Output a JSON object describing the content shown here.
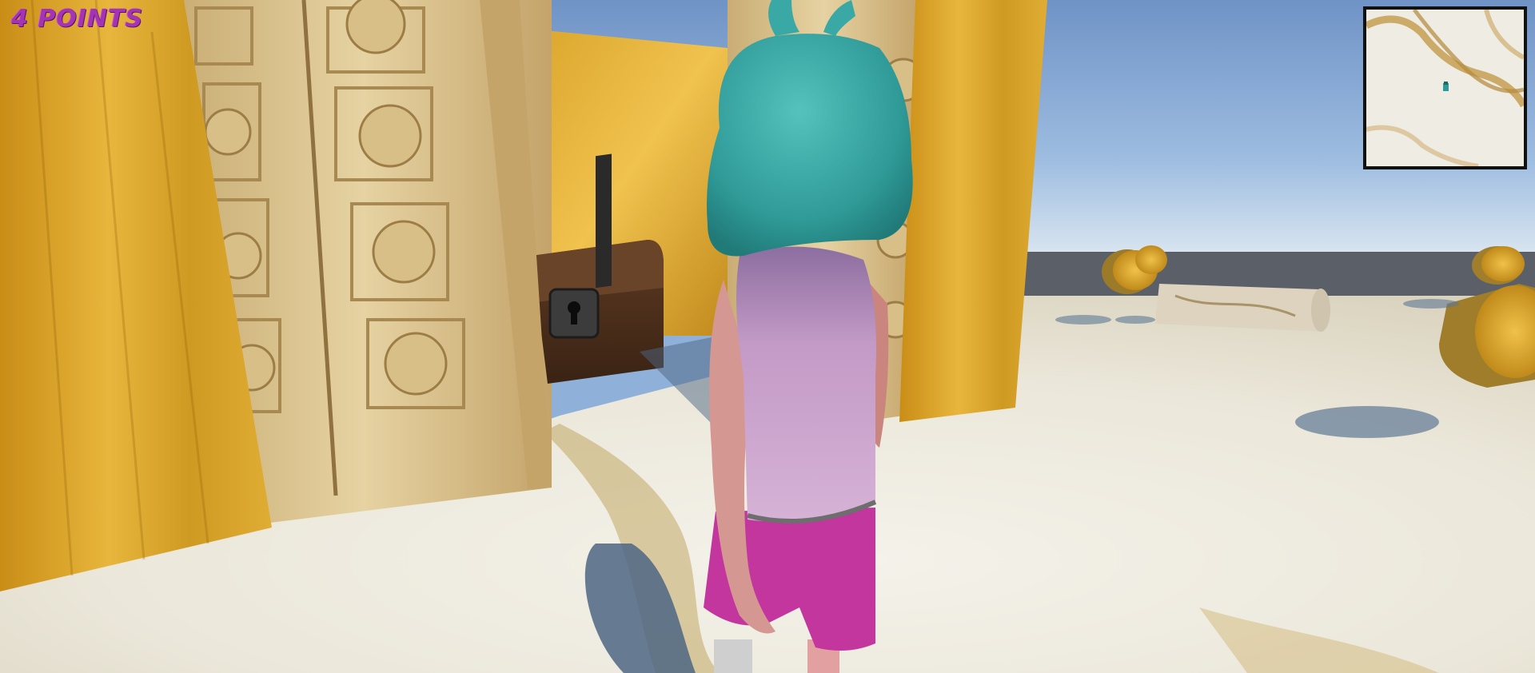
{
  "hud": {
    "score_text": "4 POINTS",
    "score_color": "#a534b4"
  },
  "minimap": {
    "player_marker_icon": "player-marker-icon"
  },
  "scene": {
    "sky_color": "#7ea3d2",
    "floor_color": "#ece9e0",
    "gold_color": "#d8a42a",
    "hair_color": "#3aa8a4",
    "shirt_color": "#c49ac4",
    "shorts_color": "#c2369e"
  }
}
